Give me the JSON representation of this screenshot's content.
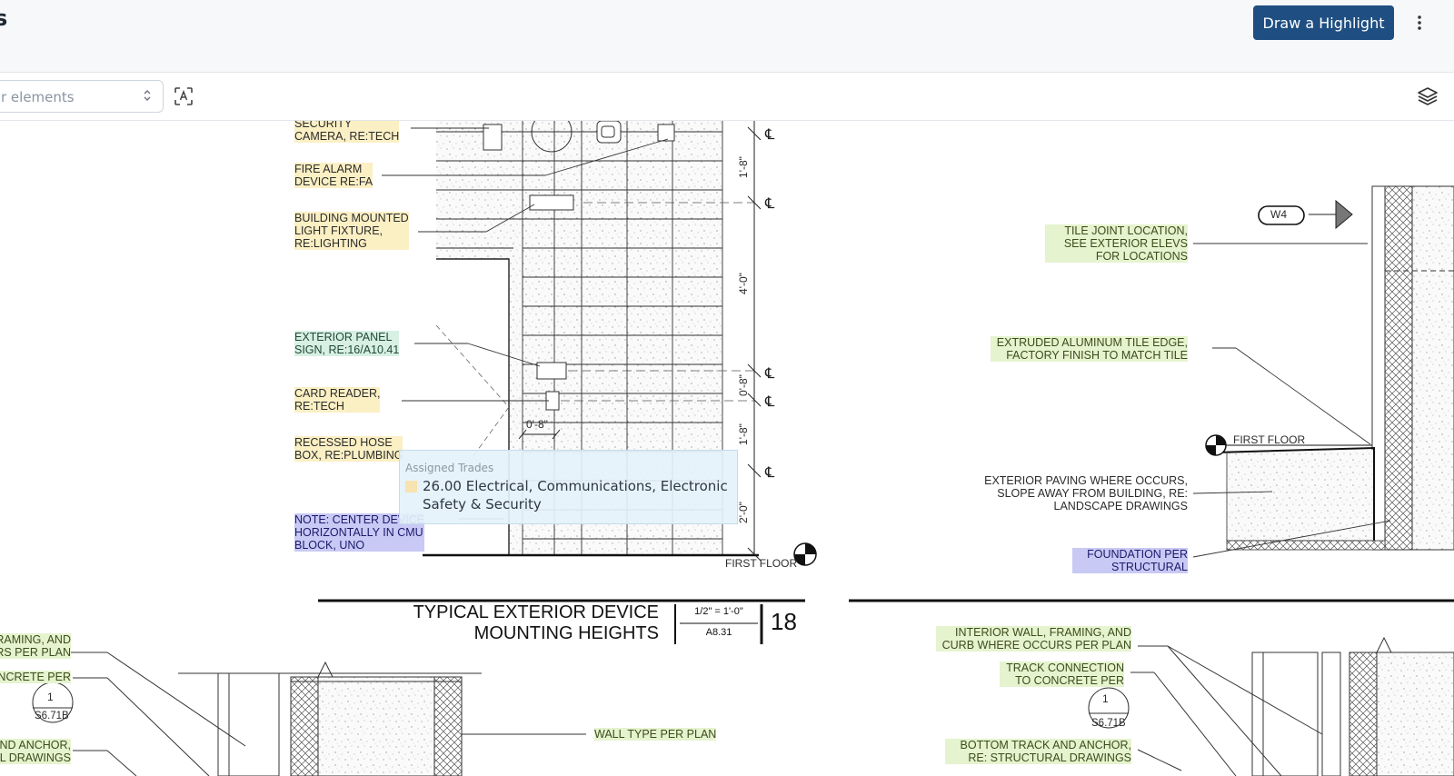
{
  "header": {
    "title": "s",
    "draw_button_label": "Draw a Highlight",
    "more_icon": "kebab-vertical-icon"
  },
  "toolbar": {
    "filter_placeholder": "r elements",
    "ocr_icon": "text-recognition-icon",
    "layers_icon": "layers-icon"
  },
  "drawing": {
    "notes_left": [
      {
        "text": "SECURITY\nCAMERA, RE:TECH",
        "highlight": "yellow"
      },
      {
        "text": "FIRE ALARM\nDEVICE RE:FA",
        "highlight": "yellow"
      },
      {
        "text": "BUILDING MOUNTED\nLIGHT FIXTURE,\nRE:LIGHTING",
        "highlight": "yellow"
      },
      {
        "text": "EXTERIOR PANEL\nSIGN, RE:16/A10.41",
        "highlight": "teal"
      },
      {
        "text": "CARD READER,\nRE:TECH",
        "highlight": "yellow"
      },
      {
        "text": "RECESSED HOSE\nBOX, RE:PLUMBING",
        "highlight": "yellow"
      },
      {
        "text": "NOTE: CENTER DEVICE\nHORIZONTALLY IN CMU\nBLOCK, UNO",
        "highlight": "blue"
      }
    ],
    "dimensions": [
      "1'-8\"",
      "4'-0\"",
      "0'-8\"",
      "1'-8\"",
      "2'-0\"",
      "0'-8\""
    ],
    "first_floor_label": "FIRST FLOOR",
    "detail_18": {
      "title_line1": "TYPICAL EXTERIOR DEVICE",
      "title_line2": "MOUNTING HEIGHTS",
      "scale": "1/2\" = 1'-0\"",
      "sheet": "A8.31",
      "number": "18"
    },
    "notes_right": [
      {
        "text": "TILE JOINT LOCATION,\nSEE EXTERIOR ELEVS\nFOR LOCATIONS",
        "highlight": "green"
      },
      {
        "text": "EXTRUDED ALUMINUM TILE EDGE,\nFACTORY FINISH TO MATCH TILE",
        "highlight": "green"
      },
      {
        "text": "EXTERIOR PAVING WHERE OCCURS,\nSLOPE AWAY FROM BUILDING, RE:\nLANDSCAPE DRAWINGS",
        "highlight": "none"
      },
      {
        "text": "FOUNDATION PER\nSTRUCTURAL",
        "highlight": "blue"
      }
    ],
    "wall_tag": "W4",
    "first_floor_right": "FIRST FLOOR",
    "notes_bottom_right": [
      {
        "text": "INTERIOR WALL,  FRAMING, AND\nCURB  WHERE OCCURS PER PLAN",
        "highlight": "green"
      },
      {
        "text": "TRACK CONNECTION\nTO CONCRETE  PER",
        "highlight": "green"
      },
      {
        "text": "BOTTOM TRACK AND ANCHOR,\nRE: STRUCTURAL DRAWINGS",
        "highlight": "green"
      }
    ],
    "notes_bottom_left": [
      {
        "text": "RAMING, AND\nRS PER PLAN",
        "highlight": "green"
      },
      {
        "text": "NCRETE  PER",
        "highlight": "green"
      },
      {
        "text": "ND ANCHOR,\nL DRAWINGS",
        "highlight": "green"
      }
    ],
    "wall_type_note": "WALL TYPE PER PLAN",
    "bubble_left": {
      "top": "1",
      "bottom": "S6.71B"
    },
    "bubble_right": {
      "top": "1",
      "bottom": "S6.71B"
    }
  },
  "tooltip": {
    "title": "Assigned Trades",
    "body": "26.00 Electrical, Communications, Electronic Safety & Security",
    "swatch_color": "#f7e3b0"
  },
  "colors": {
    "primary_button": "#1f4f82",
    "highlight_yellow": "#fbefc4",
    "highlight_green": "#e6f3cf",
    "highlight_blue": "#c9c9f5"
  }
}
